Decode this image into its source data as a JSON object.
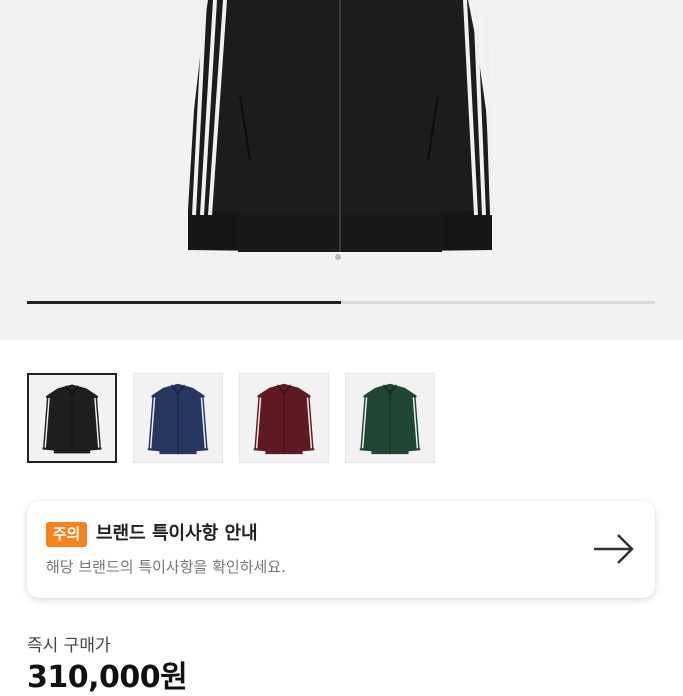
{
  "product_image": {
    "product": "black track jacket with three white stripes",
    "icon": "product-photo"
  },
  "carousel": {
    "progress": 0.5
  },
  "color_options": [
    {
      "name": "black",
      "color": "#1e1e1e",
      "selected": true
    },
    {
      "name": "navy",
      "color": "#263660",
      "selected": false
    },
    {
      "name": "burgundy",
      "color": "#5e1a20",
      "selected": false
    },
    {
      "name": "green",
      "color": "#1f4633",
      "selected": false
    }
  ],
  "notice": {
    "badge": "주의",
    "title": "브랜드 특이사항 안내",
    "description": "해당 브랜드의 특이사항을 확인하세요.",
    "arrow_icon": "arrow-right-icon",
    "badge_color": "#f5811f"
  },
  "price": {
    "label": "즉시 구매가",
    "value": "310,000원"
  }
}
